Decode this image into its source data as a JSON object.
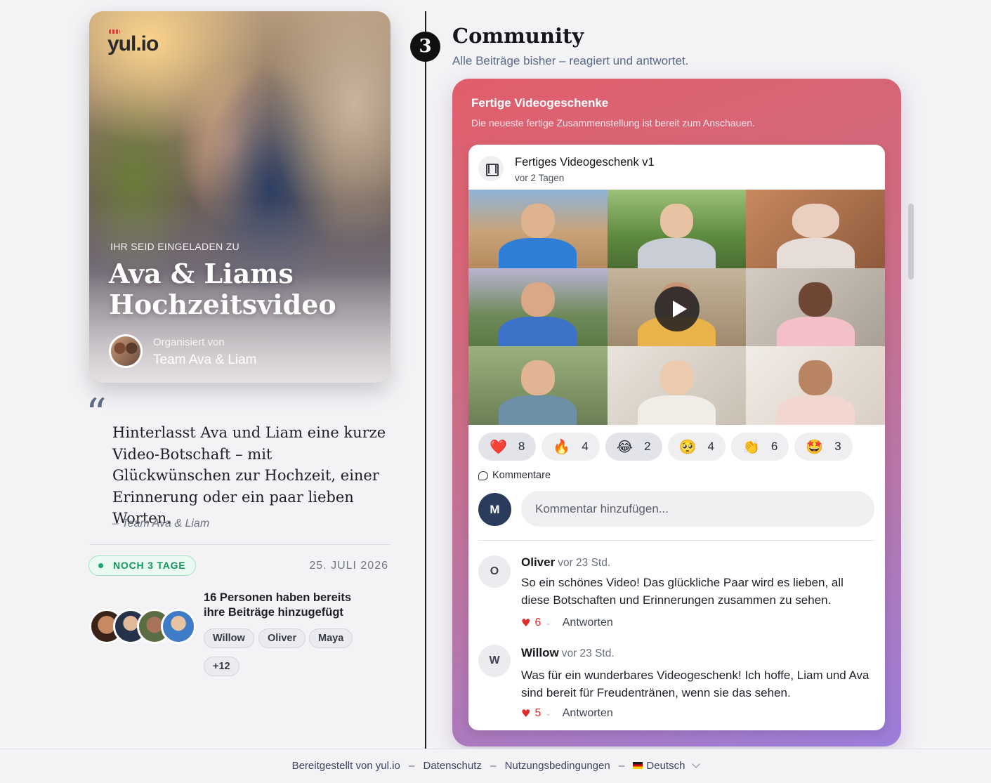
{
  "hero": {
    "logo": "yul.io",
    "invite_label": "IHR SEID EINGELADEN ZU",
    "title": "Ava & Liams Hochzeitsvideo",
    "organized_label": "Organisiert von",
    "organizer": "Team Ava & Liam"
  },
  "quote": {
    "text": "Hinterlasst Ava und Liam eine kurze Video-Botschaft – mit Glückwünschen zur Hochzeit, einer Erinnerung oder ein paar lieben Worten.",
    "author": "– Team Ava & Liam"
  },
  "deadline": {
    "badge": "NOCH 3 TAGE",
    "date": "25. JULI 2026"
  },
  "contributors": {
    "summary": "16 Personen haben bereits ihre Beiträge hinzugefügt",
    "names": [
      "Willow",
      "Oliver",
      "Maya"
    ],
    "more": "+12"
  },
  "section": {
    "step": "3",
    "title": "Community",
    "subtitle": "Alle Beiträge bisher – reagiert und antwortet."
  },
  "panel": {
    "title": "Fertige Videogeschenke",
    "subtitle": "Die neueste fertige Zusammenstellung ist bereit zum Anschauen."
  },
  "video_card": {
    "icon": "film-icon",
    "title": "Fertiges Videogeschenk v1",
    "time": "vor 2 Tagen",
    "reactions": [
      {
        "emoji": "❤️",
        "count": "8"
      },
      {
        "emoji": "🔥",
        "count": "4"
      },
      {
        "emoji": "😂",
        "count": "2"
      },
      {
        "emoji": "🥺",
        "count": "4"
      },
      {
        "emoji": "👏",
        "count": "6"
      },
      {
        "emoji": "🤩",
        "count": "3"
      }
    ],
    "comments_label": "Kommentare",
    "my_initial": "M",
    "comment_placeholder": "Kommentar hinzufügen..."
  },
  "comments": [
    {
      "initial": "O",
      "name": "Oliver",
      "time": "vor 23 Std.",
      "text": "So ein schönes Video! Das glückliche Paar wird es lieben, all diese Botschaften und Erinnerungen zusammen zu sehen.",
      "likes": "6",
      "reply": "Antworten"
    },
    {
      "initial": "W",
      "name": "Willow",
      "time": "vor 23 Std.",
      "text": "Was für ein wunderbares Videogeschenk! Ich hoffe, Liam und Ava sind bereit für Freudentränen, wenn sie das sehen.",
      "likes": "5",
      "reply": "Antworten"
    }
  ],
  "footer": {
    "powered": "Bereitgestellt von yul.io",
    "privacy": "Datenschutz",
    "terms": "Nutzungsbedingungen",
    "language": "Deutsch"
  }
}
